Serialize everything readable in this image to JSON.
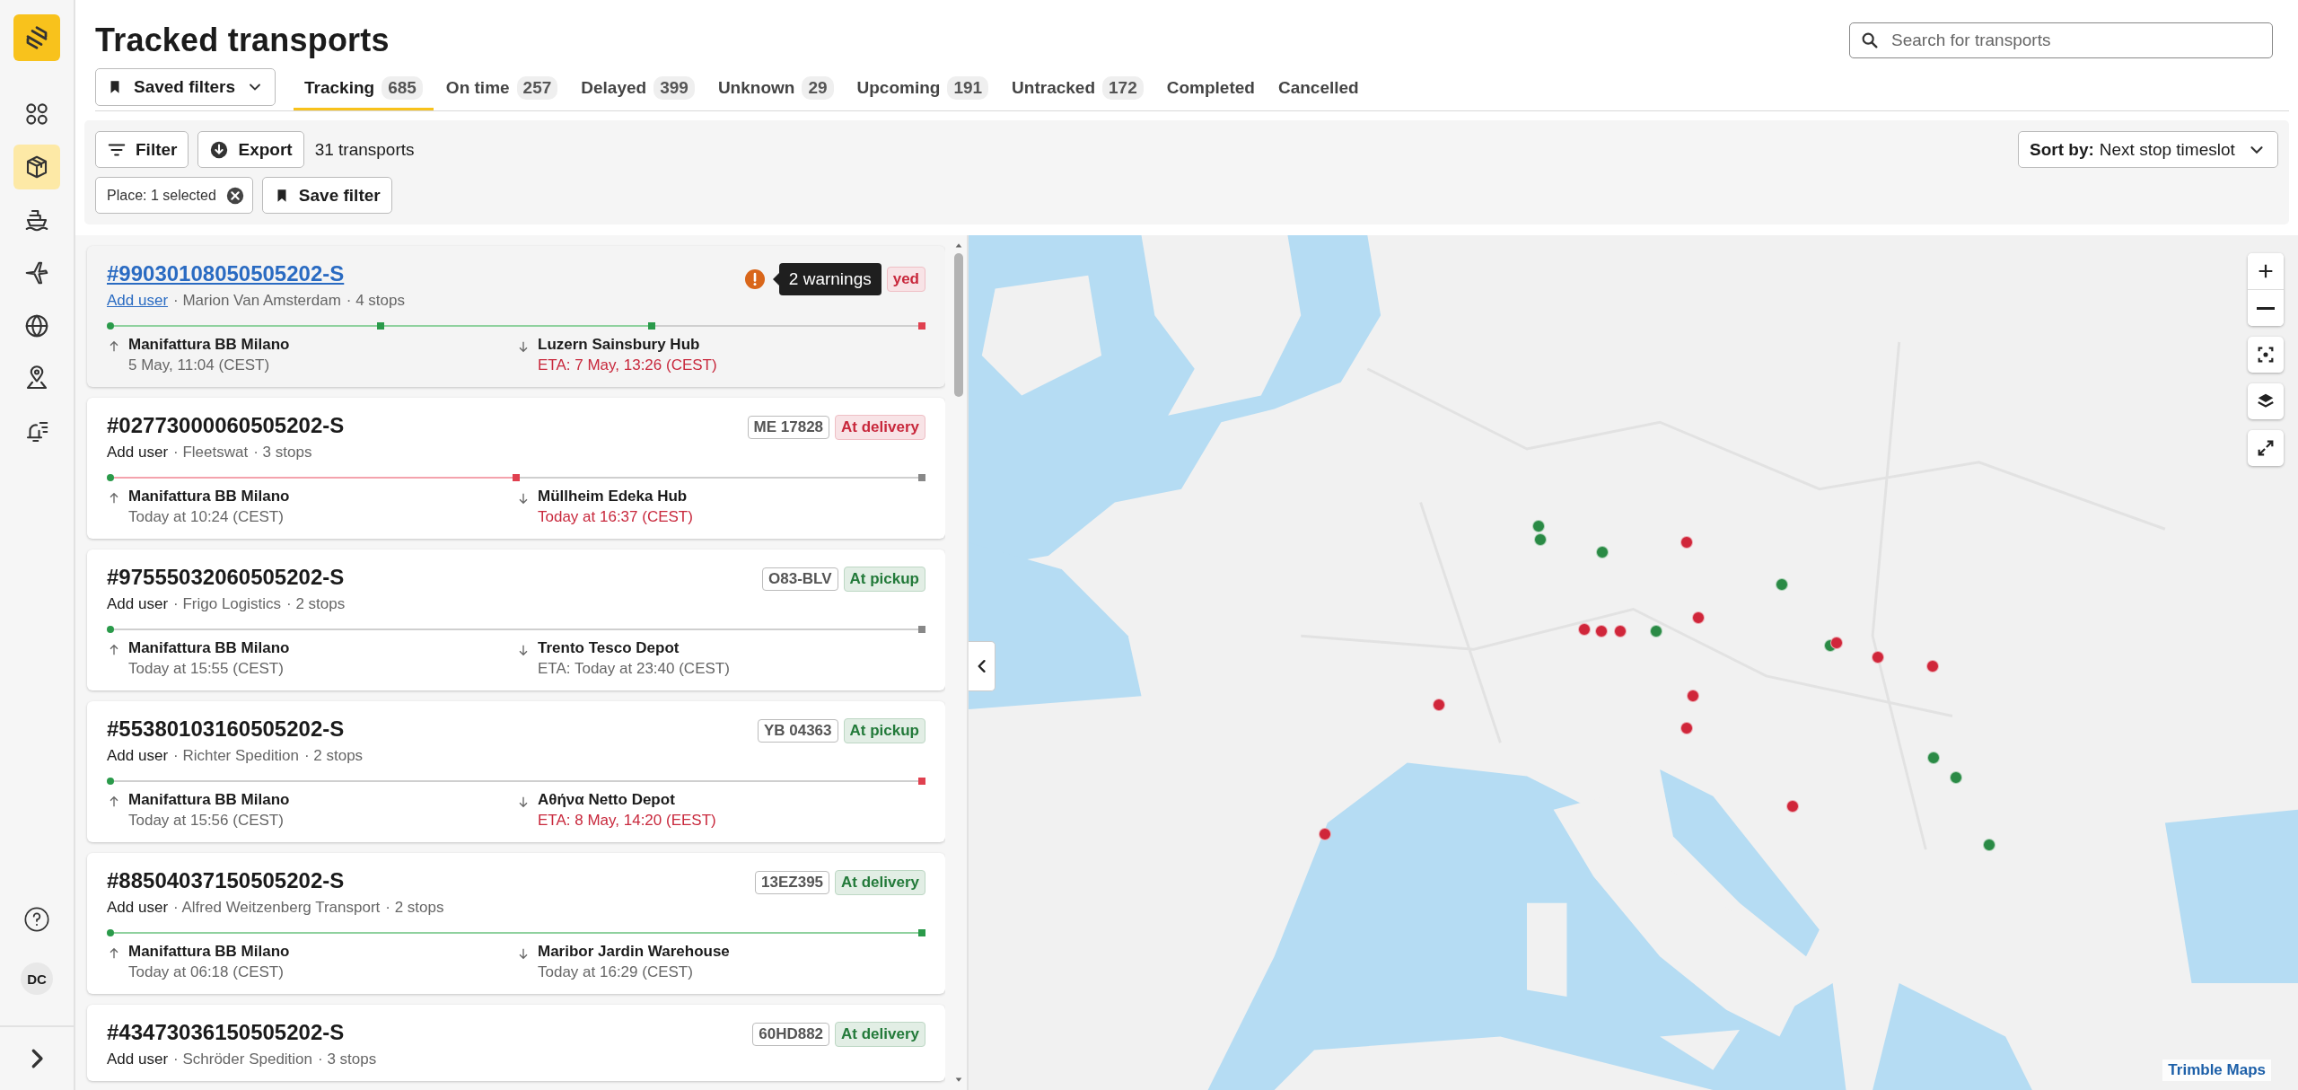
{
  "sidebar": {
    "items": [
      {
        "selected": false
      },
      {
        "selected": true
      },
      {
        "selected": false
      },
      {
        "selected": false
      },
      {
        "selected": false
      },
      {
        "selected": false
      },
      {
        "selected": false
      }
    ],
    "avatar": "DC"
  },
  "header": {
    "title": "Tracked transports",
    "search": {
      "placeholder": "Search for transports"
    }
  },
  "saved_filters": "Saved filters",
  "tabs": [
    {
      "label": "Tracking",
      "count": "685",
      "selected": true
    },
    {
      "label": "On time",
      "count": "257",
      "selected": false
    },
    {
      "label": "Delayed",
      "count": "399",
      "selected": false
    },
    {
      "label": "Unknown",
      "count": "29",
      "selected": false
    },
    {
      "label": "Upcoming",
      "count": "191",
      "selected": false
    },
    {
      "label": "Untracked",
      "count": "172",
      "selected": false
    },
    {
      "label": "Completed",
      "selected": false
    },
    {
      "label": "Cancelled",
      "selected": false
    }
  ],
  "toolbar": {
    "filter": "Filter",
    "export": "Export",
    "result_count": "31 transports",
    "sort_label": "Sort by:",
    "sort_value": "Next stop timeslot",
    "chip": "Place: 1 selected",
    "save_filter": "Save filter"
  },
  "cards": [
    {
      "id": "#99030108050505202-S",
      "selected": true,
      "user": "Add user",
      "carrier": "· Marion Van Amsterdam",
      "stops": "· 4 stops",
      "warning": {
        "tooltip": "2 warnings"
      },
      "status": {
        "text": "yed",
        "color": "#c8283c"
      },
      "route": {
        "markers": [
          {
            "color": "#2a9a4a"
          },
          {
            "color": "#2a9a4a"
          },
          {
            "color": "#2a9a4a"
          },
          {
            "color": "#e0404f"
          }
        ],
        "segments": [
          {
            "color": "#8fd19e"
          },
          {
            "color": "#8fd19e"
          },
          {
            "color": "#cfcfcf"
          }
        ]
      },
      "from": {
        "place": "Manifattura BB Milano",
        "time": "5 May, 11:04 (CEST)"
      },
      "to": {
        "place": "Luzern Sainsbury Hub",
        "time": "ETA: 7 May, 13:26 (CEST)",
        "late": true
      }
    },
    {
      "id": "#02773000060505202-S",
      "selected": false,
      "user": "Add user",
      "carrier": "· Fleetswat",
      "stops": "· 3 stops",
      "plate": "ME 17828",
      "status": {
        "text": "At delivery",
        "color": "#c8283c"
      },
      "route": {
        "markers": [
          {
            "color": "#2a9a4a"
          },
          {
            "color": "#e0404f"
          },
          {
            "color": "#888888"
          }
        ],
        "segments": [
          {
            "color": "#f4a3ad"
          },
          {
            "color": "#cfcfcf"
          }
        ]
      },
      "from": {
        "place": "Manifattura BB Milano",
        "time": "Today at 10:24 (CEST)"
      },
      "to": {
        "place": "Müllheim Edeka Hub",
        "time": "Today at 16:37 (CEST)",
        "late": true
      }
    },
    {
      "id": "#97555032060505202-S",
      "selected": false,
      "user": "Add user",
      "carrier": "· Frigo Logistics",
      "stops": "· 2 stops",
      "plate": "O83-BLV",
      "status": {
        "text": "At pickup",
        "color": "#237a3a"
      },
      "route": {
        "markers": [
          {
            "color": "#2a9a4a"
          },
          {
            "color": "#888888"
          }
        ],
        "segments": [
          {
            "color": "#cfcfcf"
          }
        ]
      },
      "from": {
        "place": "Manifattura BB Milano",
        "time": "Today at 15:55 (CEST)"
      },
      "to": {
        "place": "Trento Tesco Depot",
        "time": "ETA: Today at 23:40 (CEST)",
        "late": false
      }
    },
    {
      "id": "#55380103160505202-S",
      "selected": false,
      "user": "Add user",
      "carrier": "· Richter Spedition",
      "stops": "· 2 stops",
      "plate": "YB 04363",
      "status": {
        "text": "At pickup",
        "color": "#237a3a"
      },
      "route": {
        "markers": [
          {
            "color": "#2a9a4a"
          },
          {
            "color": "#e0404f"
          }
        ],
        "segments": [
          {
            "color": "#cfcfcf"
          }
        ]
      },
      "from": {
        "place": "Manifattura BB Milano",
        "time": "Today at 15:56 (CEST)"
      },
      "to": {
        "place": "Αθήνα Netto Depot",
        "time": "ETA: 8 May, 14:20 (EEST)",
        "late": true
      }
    },
    {
      "id": "#88504037150505202-S",
      "selected": false,
      "user": "Add user",
      "carrier": "· Alfred Weitzenberg Transport",
      "stops": "· 2 stops",
      "plate": "13EZ395",
      "status": {
        "text": "At delivery",
        "color": "#237a3a"
      },
      "route": {
        "markers": [
          {
            "color": "#2a9a4a"
          },
          {
            "color": "#2a9a4a"
          }
        ],
        "segments": [
          {
            "color": "#8fd19e"
          }
        ]
      },
      "from": {
        "place": "Manifattura BB Milano",
        "time": "Today at 06:18 (CEST)"
      },
      "to": {
        "place": "Maribor Jardin Warehouse",
        "time": "Today at 16:29 (CEST)",
        "late": false
      }
    },
    {
      "id": "#43473036150505202-S",
      "selected": false,
      "user": "Add user",
      "carrier": "· Schröder Spedition",
      "stops": "· 3 stops",
      "plate": "60HD882",
      "status": {
        "text": "At delivery",
        "color": "#237a3a"
      }
    }
  ],
  "map": {
    "kind": "picture",
    "markers": [
      {
        "color": "#2a8a45"
      },
      {
        "color": "#2a8a45"
      },
      {
        "color": "#2a8a45"
      },
      {
        "color": "#2a8a45"
      },
      {
        "color": "#2a8a45"
      },
      {
        "color": "#2a8a45"
      },
      {
        "color": "#2a8a45"
      },
      {
        "color": "#2a8a45"
      },
      {
        "color": "#2a8a45"
      },
      {
        "color": "#d0263a"
      },
      {
        "color": "#d0263a"
      },
      {
        "color": "#d0263a"
      },
      {
        "color": "#d0263a"
      },
      {
        "color": "#d0263a"
      },
      {
        "color": "#d0263a"
      },
      {
        "color": "#d0263a"
      },
      {
        "color": "#d0263a"
      },
      {
        "color": "#d0263a"
      },
      {
        "color": "#d0263a"
      },
      {
        "color": "#d0263a"
      },
      {
        "color": "#d0263a"
      },
      {
        "color": "#d0263a"
      }
    ],
    "attribution": "Trimble Maps"
  }
}
